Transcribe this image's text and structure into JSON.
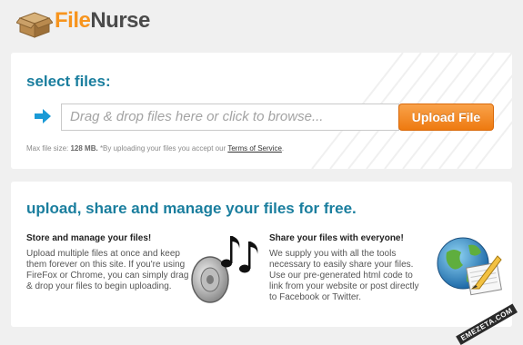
{
  "brand": {
    "part1": "File",
    "part2": "Nurse"
  },
  "select": {
    "title": "select files:",
    "placeholder": "Drag & drop files here or click to browse...",
    "upload_label": "Upload File",
    "hint_prefix": "Max file size:",
    "hint_size": "128 MB.",
    "hint_middle": "*By uploading your files you accept our",
    "tos_label": "Terms of Service",
    "hint_suffix": "."
  },
  "info": {
    "title": "upload, share and manage your files for free.",
    "store": {
      "heading": "Store and manage your files!",
      "body": "Upload multiple files at once and keep them forever on this site. If you're using FireFox or Chrome, you can simply drag & drop your files to begin uploading."
    },
    "share": {
      "heading": "Share your files with everyone!",
      "body": "We supply you with all the tools necessary to easily share your files. Use our pre-generated html code to link from your website or post directly to Facebook or Twitter."
    }
  },
  "watermark": "EMEZETA.COM",
  "colors": {
    "accent": "#1a7e9e",
    "button": "#f7941d",
    "arrow": "#1a9ad6"
  },
  "icons": [
    "box-logo-icon",
    "arrow-right-icon",
    "speaker-music-icon",
    "globe-pencil-icon"
  ]
}
